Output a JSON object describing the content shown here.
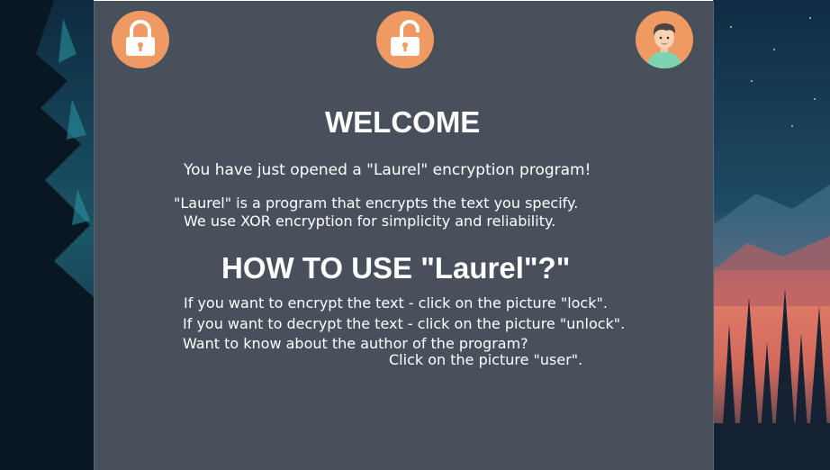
{
  "icons": {
    "lock": "lock-icon",
    "unlock": "unlock-icon",
    "user": "user-avatar-icon"
  },
  "colors": {
    "panel_bg": "#47505b",
    "icon_circle": "#ee9a62",
    "icon_body": "#ffffff",
    "text": "#ffffff"
  },
  "welcome": {
    "title": "WELCOME",
    "intro": "You have just opened a \"Laurel\" encryption program!",
    "desc_line1": "\"Laurel\" is a program that encrypts the text you specify.",
    "desc_line2": "We use XOR encryption for simplicity and reliability."
  },
  "howto": {
    "title": "HOW TO USE \"Laurel\"?\"",
    "line1": "If you want to encrypt the text - click on the picture \"lock\".",
    "line2": "If you want to decrypt the text - click on the picture \"unlock\".",
    "line3": "Want to know about the author of the program?",
    "line4": "Click on the picture \"user\"."
  }
}
